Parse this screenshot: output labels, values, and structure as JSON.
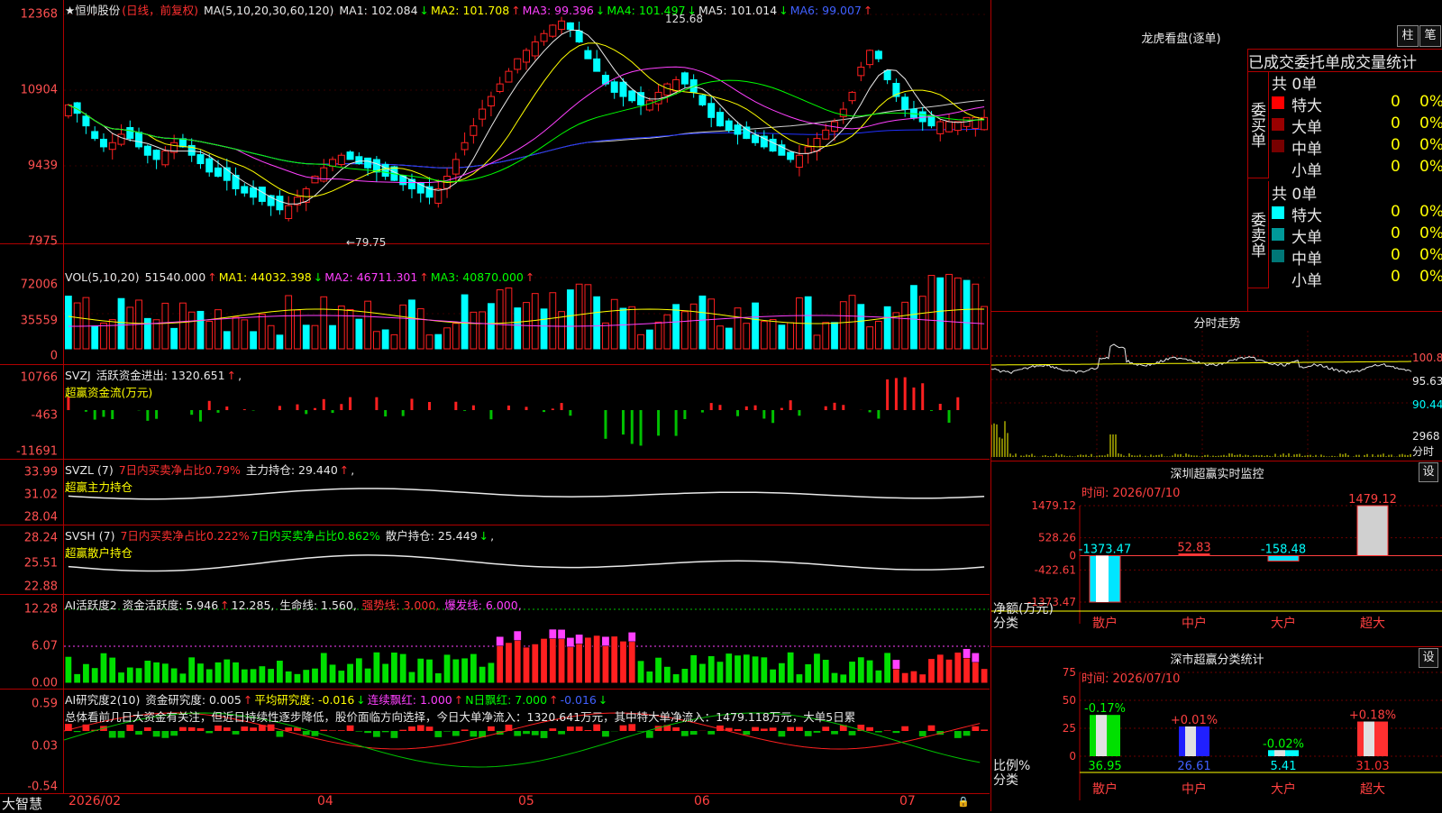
{
  "app": {
    "brand": "大智慧"
  },
  "stock": {
    "name": "★恒帅股份",
    "period": "(日线，前复权)"
  },
  "main_chart": {
    "title": "MA(5,10,20,30,60,120)",
    "ma": [
      {
        "label": "MA1: 102.084",
        "arrow": "↓",
        "color": "#e8e8e8"
      },
      {
        "label": "MA2: 101.708",
        "arrow": "↑",
        "color": "#ffff00"
      },
      {
        "label": "MA3: 99.396",
        "arrow": "↓",
        "color": "#ff40ff"
      },
      {
        "label": "MA4: 101.497",
        "arrow": "↓",
        "color": "#00ff00"
      },
      {
        "label": "MA5: 101.014",
        "arrow": "↓",
        "color": "#e8e8e8"
      },
      {
        "label": "MA6: 99.007",
        "arrow": "↑",
        "color": "#4060ff"
      }
    ],
    "yticks": [
      "12368",
      "10904",
      "9439",
      "7975"
    ],
    "high_label": "125.68",
    "low_label": "←79.75"
  },
  "vol": {
    "title": "VOL(5,10,20)",
    "value": "51540.000",
    "arrow": "↑",
    "ma1": "MA1: 44032.398",
    "ma1_arrow": "↓",
    "ma2": "MA2: 46711.301",
    "ma2_arrow": "↑",
    "ma3": "MA3: 40870.000",
    "ma3_arrow": "↑",
    "yticks": [
      "72006",
      "35559",
      "0"
    ]
  },
  "svzj": {
    "title": "SVZJ",
    "line1": "活跃资金进出: 1320.651",
    "arrow": "↑",
    "sep": ",",
    "line2": "超赢资金流(万元)",
    "yticks": [
      "10766",
      "-463",
      "-11691"
    ]
  },
  "svzl": {
    "title": "SVZL (7)",
    "pct": "7日内买卖净占比0.79%",
    "hold": "主力持仓: 29.440",
    "arrow": "↑",
    "sep": ",",
    "line2": "超赢主力持仓",
    "yticks": [
      "33.99",
      "31.02",
      "28.04"
    ]
  },
  "svsh": {
    "title": "SVSH (7)",
    "pct1": "7日内买卖净占比0.222%",
    "pct2": "7日内买卖净占比0.862%",
    "hold": "散户持仓: 25.449",
    "arrow": "↓",
    "sep": ",",
    "line2": "超赢散户持仓",
    "yticks": [
      "28.24",
      "25.51",
      "22.88"
    ]
  },
  "ai1": {
    "title": "AI活跃度2",
    "act": "资金活跃度: 5.946",
    "act_arrow": "↑",
    "v2": "12.285,",
    "life": "生命线: 1.560,",
    "strong": "强势线: 3.000,",
    "burst": "爆发线: 6.000,",
    "yticks": [
      "12.28",
      "6.07",
      "0.00"
    ]
  },
  "ai2": {
    "title": "AI研究度2(10)",
    "res": "资金研究度: 0.005",
    "res_arrow": "↑",
    "avg": "平均研究度: -0.016",
    "avg_arrow": "↓",
    "red": "连续飘红: 1.000",
    "red_arrow": "↑",
    "nred": "N日飘红: 7.000",
    "nred_arrow": "↑",
    "last": "-0.016",
    "last_arrow": "↓",
    "summary": "总体看前几日大资金有关注，但近日持续性逐步降低，股价面临方向选择，今日大单净流入：1320.641万元，其中特大单净流入：1479.118万元，大单5日累",
    "yticks": [
      "0.59",
      "0.03",
      "-0.54"
    ]
  },
  "xaxis": [
    "2026/02",
    "04",
    "05",
    "06",
    "07"
  ],
  "lhb": {
    "title": "龙虎看盘(逐单)",
    "btn1": "柱",
    "btn2": "笔",
    "tabs": "已成交委托单成交量统计",
    "buy": {
      "side": "委买单",
      "total": "共 0单",
      "rows": [
        {
          "label": "特大",
          "v": "0",
          "p": "0%",
          "c": "#ff0000"
        },
        {
          "label": "大单",
          "v": "0",
          "p": "0%",
          "c": "#990000"
        },
        {
          "label": "中单",
          "v": "0",
          "p": "0%",
          "c": "#770000"
        },
        {
          "label": "小单",
          "v": "0",
          "p": "0%",
          "c": "#000000"
        }
      ]
    },
    "sell": {
      "side": "委卖单",
      "total": "共 0单",
      "rows": [
        {
          "label": "特大",
          "v": "0",
          "p": "0%",
          "c": "#00ffff"
        },
        {
          "label": "大单",
          "v": "0",
          "p": "0%",
          "c": "#009999"
        },
        {
          "label": "中单",
          "v": "0",
          "p": "0%",
          "c": "#007777"
        },
        {
          "label": "小单",
          "v": "0",
          "p": "0%",
          "c": "#000000"
        }
      ]
    }
  },
  "intraday": {
    "title": "分时走势",
    "yticks": [
      "100.8",
      "95.63",
      "90.44"
    ],
    "vol_tick": "2968",
    "vol_label": "分时"
  },
  "monitor": {
    "title": "深圳超赢实时监控",
    "btn": "设",
    "time": "时间: 2026/07/10",
    "ylabels": [
      "1479.12",
      "528.26",
      "0",
      "-422.61",
      "-1373.47"
    ],
    "ylabel": "净额(万元)",
    "xlabel": "分类",
    "bars": [
      {
        "cat": "散户",
        "value": -1373.47,
        "label": "-1373.47"
      },
      {
        "cat": "中户",
        "value": 52.83,
        "label": "52.83"
      },
      {
        "cat": "大户",
        "value": -158.48,
        "label": "-158.48"
      },
      {
        "cat": "超大",
        "value": 1479.12,
        "label": "1479.12"
      }
    ]
  },
  "classify": {
    "title": "深市超赢分类统计",
    "btn": "设",
    "time": "时间: 2026/07/10",
    "yticks": [
      "75",
      "50",
      "25",
      "0"
    ],
    "ylabel": "比例%",
    "xlabel": "分类",
    "bars": [
      {
        "cat": "散户",
        "pct": 36.95,
        "label": "36.95",
        "chg": "-0.17%"
      },
      {
        "cat": "中户",
        "pct": 26.61,
        "label": "26.61",
        "chg": "+0.01%"
      },
      {
        "cat": "大户",
        "pct": 5.41,
        "label": "5.41",
        "chg": "-0.02%"
      },
      {
        "cat": "超大",
        "pct": 31.03,
        "label": "31.03",
        "chg": "+0.18%"
      }
    ]
  }
}
